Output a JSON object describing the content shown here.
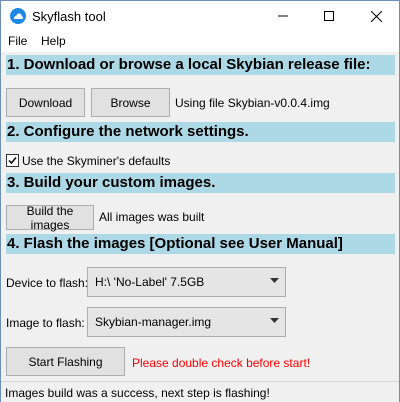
{
  "window": {
    "title": "Skyflash tool",
    "minimize_glyph": "—",
    "maximize_glyph": "☐",
    "close_glyph": "✕"
  },
  "menu": {
    "items": [
      "File",
      "Help"
    ]
  },
  "sections": {
    "download": {
      "header": "1. Download or browse a local Skybian release file:",
      "download_button": "Download",
      "browse_button": "Browse",
      "status": "Using file Skybian-v0.0.4.img"
    },
    "network": {
      "header": "2. Configure the network settings.",
      "defaults_checkbox_label": "Use the Skyminer's defaults",
      "defaults_checked": true
    },
    "build": {
      "header": "3. Build your custom images.",
      "build_button": "Build the images",
      "status": "All images was built"
    },
    "flash": {
      "header": "4. Flash the images [Optional see User Manual]",
      "device_label": "Device to flash:",
      "device_value": "H:\\ 'No-Label' 7.5GB",
      "image_label": "Image to flash:",
      "image_value": "Skybian-manager.img",
      "start_button": "Start Flashing",
      "warning": "Please double check before start!"
    }
  },
  "statusbar": {
    "text": "Images build was a success, next step is flashing!"
  },
  "colors": {
    "section_bg": "#add8e6",
    "warning": "#ff0000",
    "app_icon": "#1e88e5"
  }
}
